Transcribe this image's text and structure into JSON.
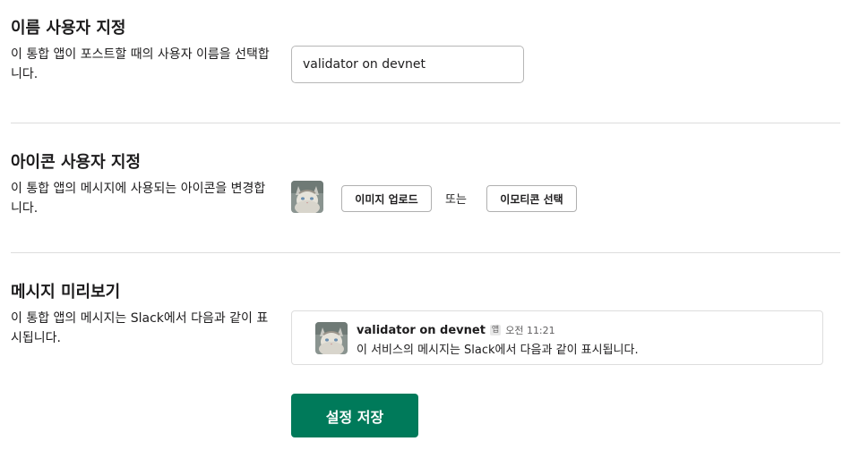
{
  "name_section": {
    "title": "이름 사용자 지정",
    "description": "이 통합 앱이 포스트할 때의 사용자 이름을 선택합니다.",
    "input_value": "validator on devnet"
  },
  "icon_section": {
    "title": "아이콘 사용자 지정",
    "description": "이 통합 앱의 메시지에 사용되는 아이콘을 변경합니다.",
    "upload_button": "이미지 업로드",
    "or_text": "또는",
    "emoji_button": "이모티콘 선택",
    "avatar_icon": "cat-avatar-icon"
  },
  "preview_section": {
    "title": "메시지 미리보기",
    "description": "이 통합 앱의 메시지는 Slack에서 다음과 같이 표시됩니다.",
    "message": {
      "sender": "validator on devnet",
      "badge": "앱",
      "time": "오전 11:21",
      "text": "이 서비스의 메시지는 Slack에서 다음과 같이 표시됩니다."
    }
  },
  "save_button": "설정 저장",
  "colors": {
    "primary": "#007a5a",
    "divider": "#dddddd",
    "text": "#1d1c1d"
  }
}
